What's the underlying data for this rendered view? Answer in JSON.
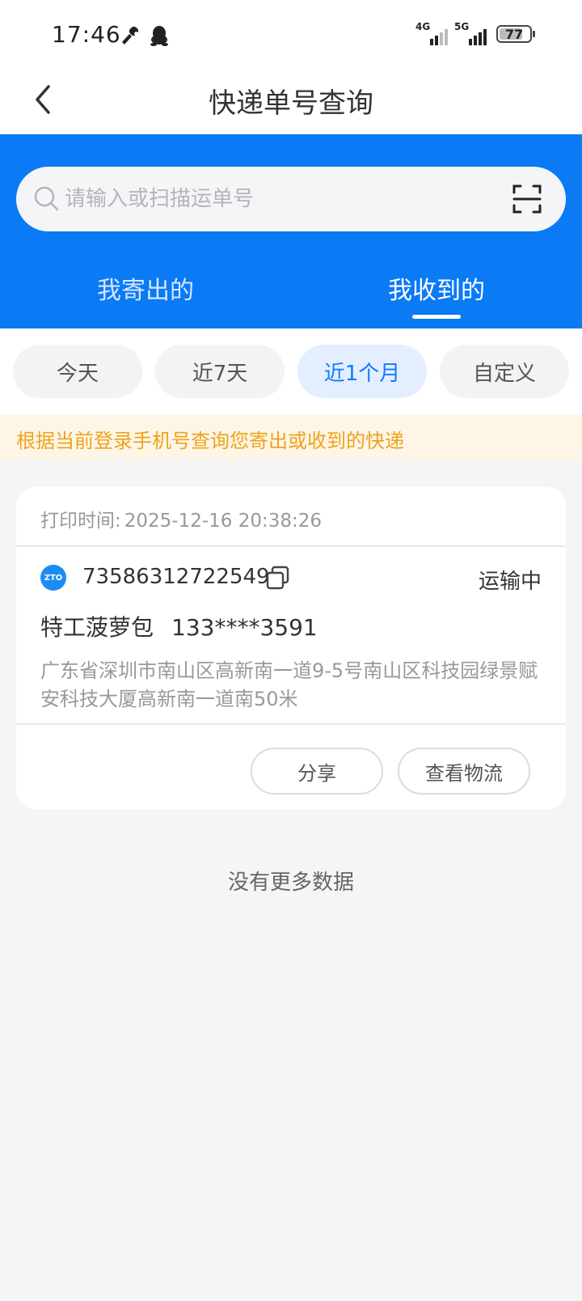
{
  "status_bar": {
    "time": "17:46",
    "network_1": "4G",
    "network_2": "5G",
    "battery": "77",
    "icons": [
      "tool-icon",
      "qq-penguin-icon"
    ]
  },
  "nav": {
    "title": "快递单号查询",
    "back_icon": "chevron-left-icon"
  },
  "search": {
    "placeholder": "请输入或扫描运单号",
    "value": "",
    "scan_icon": "scan-icon"
  },
  "tabs": [
    {
      "label": "我寄出的",
      "active": false
    },
    {
      "label": "我收到的",
      "active": true
    }
  ],
  "filters": [
    {
      "label": "今天",
      "selected": false
    },
    {
      "label": "近7天",
      "selected": false
    },
    {
      "label": "近1个月",
      "selected": true
    },
    {
      "label": "自定义",
      "selected": false
    }
  ],
  "notice": "根据当前登录手机号查询您寄出或收到的快递",
  "shipments": [
    {
      "print_time_label": "打印时间:",
      "print_time": "2025-12-16 20:38:26",
      "carrier_logo_text": "ZTO",
      "tracking_number": "73586312722549",
      "status": "运输中",
      "recipient_name": "特工菠萝包",
      "recipient_phone": "133****3591",
      "address": "广东省深圳市南山区高新南一道9-5号南山区科技园绿景赋安科技大厦高新南一道南50米",
      "actions": {
        "share": "分享",
        "view_logistics": "查看物流"
      }
    }
  ],
  "no_more_text": "没有更多数据",
  "colors": {
    "primary_blue": "#0a7af5",
    "chip_selected_text": "#1677ff",
    "notice_text": "#f0a21c",
    "notice_bg": "#fdf6e7"
  }
}
